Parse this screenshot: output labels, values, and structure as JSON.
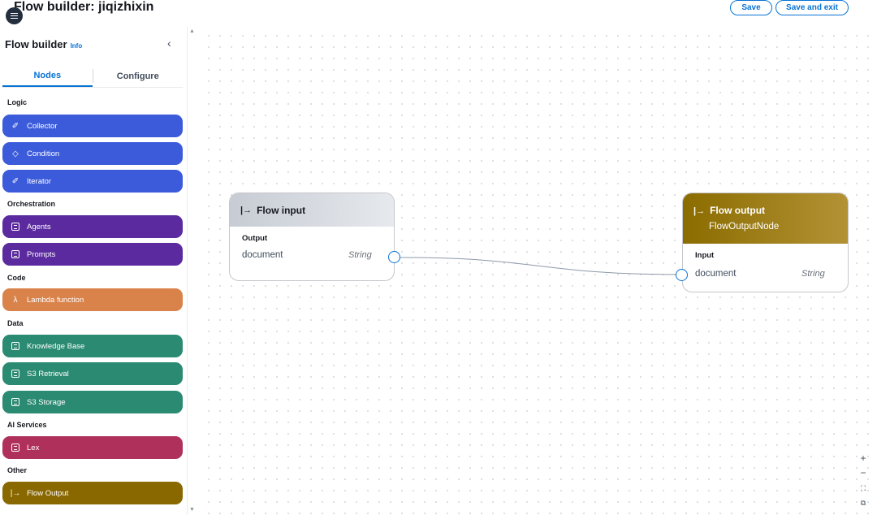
{
  "header": {
    "title": "Flow builder: jiqizhixin",
    "save_label": "Save",
    "save_exit_label": "Save and exit"
  },
  "sidebar": {
    "title": "Flow builder",
    "info_label": "Info",
    "tabs": [
      {
        "label": "Nodes",
        "active": true
      },
      {
        "label": "Configure",
        "active": false
      }
    ],
    "sections": [
      {
        "label": "Logic",
        "items": [
          {
            "label": "Collector",
            "icon": "collector-icon",
            "color": "#3b5bdb"
          },
          {
            "label": "Condition",
            "icon": "condition-icon",
            "color": "#3b5bdb"
          },
          {
            "label": "Iterator",
            "icon": "iterator-icon",
            "color": "#3b5bdb"
          }
        ]
      },
      {
        "label": "Orchestration",
        "items": [
          {
            "label": "Agents",
            "icon": "agents-icon",
            "color": "#5a2a9e"
          },
          {
            "label": "Prompts",
            "icon": "prompts-icon",
            "color": "#5a2a9e"
          }
        ]
      },
      {
        "label": "Code",
        "items": [
          {
            "label": "Lambda function",
            "icon": "lambda-icon",
            "color": "#d9834a"
          }
        ]
      },
      {
        "label": "Data",
        "items": [
          {
            "label": "Knowledge Base",
            "icon": "knowledge-base-icon",
            "color": "#2b8a72"
          },
          {
            "label": "S3 Retrieval",
            "icon": "s3-retrieval-icon",
            "color": "#2b8a72"
          },
          {
            "label": "S3 Storage",
            "icon": "s3-storage-icon",
            "color": "#2b8a72"
          }
        ]
      },
      {
        "label": "AI Services",
        "items": [
          {
            "label": "Lex",
            "icon": "lex-icon",
            "color": "#b0305c"
          }
        ]
      },
      {
        "label": "Other",
        "items": [
          {
            "label": "Flow Output",
            "icon": "flow-output-icon",
            "color": "#8a6800"
          }
        ]
      }
    ]
  },
  "canvas": {
    "flow_input": {
      "title": "Flow input",
      "port_label": "Output",
      "field_name": "document",
      "field_type": "String"
    },
    "flow_output": {
      "title": "Flow output",
      "subtitle": "FlowOutputNode",
      "port_label": "Input",
      "field_name": "document",
      "field_type": "String"
    },
    "zoom_controls": {
      "zoom_in": "+",
      "zoom_out": "−"
    }
  }
}
